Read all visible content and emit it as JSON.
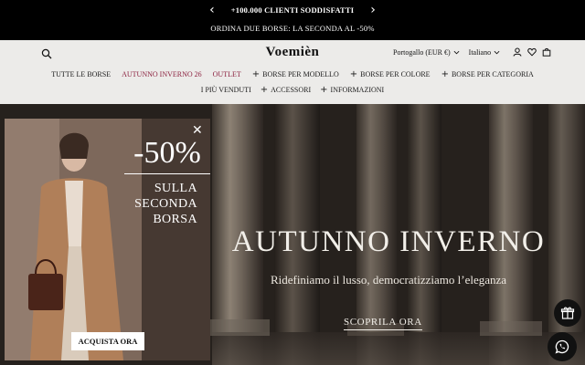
{
  "announcement": {
    "prev_icon": "chevron-left-icon",
    "message": "+100.000 CLIENTI SODDISFATTI",
    "next_icon": "chevron-right-icon",
    "promo": "ORDINA DUE BORSE: LA SECONDA AL -50%"
  },
  "header": {
    "search_icon": "search-icon",
    "logo": "Voemièn",
    "region": "Portogallo (EUR €)",
    "language": "Italiano",
    "icons": [
      "user-icon",
      "heart-icon",
      "bag-icon"
    ]
  },
  "nav": {
    "row1": [
      {
        "label": "TUTTE LE BORSE",
        "accent": false,
        "has_plus": false
      },
      {
        "label": "AUTUNNO INVERNO 26",
        "accent": true,
        "has_plus": false
      },
      {
        "label": "OUTLET",
        "accent": true,
        "has_plus": false
      },
      {
        "label": "BORSE PER MODELLO",
        "accent": false,
        "has_plus": true
      },
      {
        "label": "BORSE PER COLORE",
        "accent": false,
        "has_plus": true
      },
      {
        "label": "BORSE PER CATEGORIA",
        "accent": false,
        "has_plus": true
      }
    ],
    "row2": [
      {
        "label": "I PIÙ VENDUTI",
        "has_plus": false
      },
      {
        "label": "ACCESSORI",
        "has_plus": true
      },
      {
        "label": "INFORMAZIONI",
        "has_plus": true
      }
    ]
  },
  "hero": {
    "title": "AUTUNNO INVERNO",
    "subtitle": "Ridefiniamo il lusso, democratizziamo l’eleganza",
    "cta": "SCOPRILA ORA"
  },
  "popup": {
    "close_icon": "close-icon",
    "discount": "-50%",
    "text_lines": [
      "SULLA",
      "SECONDA",
      "BORSA"
    ],
    "cta": "ACQUISTA ORA"
  },
  "floating": {
    "gift_icon": "gift-icon",
    "whatsapp_icon": "whatsapp-icon"
  },
  "colors": {
    "accent": "#8c2240",
    "bar": "#000000",
    "header_bg": "#ecebe9"
  }
}
